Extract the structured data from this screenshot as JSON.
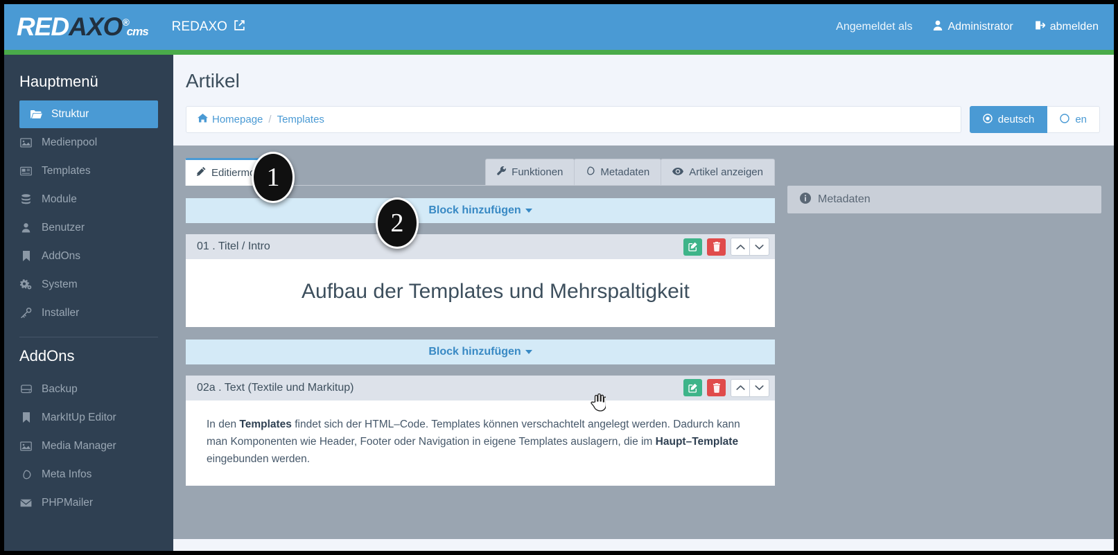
{
  "navbar": {
    "logo": {
      "part1": "RED",
      "part2": "AXO",
      "reg": "®",
      "cms": "cms"
    },
    "brand_link": "REDAXO",
    "brand_link_icon": "external-link-icon",
    "logged_in_as": "Angemeldet als",
    "user_name": "Administrator",
    "user_icon": "user-icon",
    "logout": "abmelden",
    "logout_icon": "sign-out-icon",
    "bg_color": "#4a9ad4",
    "accent_bar_color": "#4aab4a"
  },
  "sidebar": {
    "main_title": "Hauptmenü",
    "main_items": [
      {
        "label": "Struktur",
        "icon": "folder-open-icon",
        "glyph": "🗁",
        "active": true
      },
      {
        "label": "Medienpool",
        "icon": "image-icon",
        "glyph": "🖼",
        "active": false
      },
      {
        "label": "Templates",
        "icon": "newspaper-icon",
        "glyph": "🗞",
        "active": false
      },
      {
        "label": "Module",
        "icon": "database-icon",
        "glyph": "☰",
        "active": false
      },
      {
        "label": "Benutzer",
        "icon": "user-icon",
        "glyph": "👤",
        "active": false
      },
      {
        "label": "AddOns",
        "icon": "bookmark-icon",
        "glyph": "🔖",
        "active": false
      },
      {
        "label": "System",
        "icon": "cogs-icon",
        "glyph": "⚙",
        "active": false
      },
      {
        "label": "Installer",
        "icon": "key-icon",
        "glyph": "🔑",
        "active": false
      }
    ],
    "addons_title": "AddOns",
    "addon_items": [
      {
        "label": "Backup",
        "icon": "hdd-icon",
        "glyph": "⛁"
      },
      {
        "label": "MarkItUp Editor",
        "icon": "bookmark-icon",
        "glyph": "🔖"
      },
      {
        "label": "Media Manager",
        "icon": "image-icon",
        "glyph": "🖼"
      },
      {
        "label": "Meta Infos",
        "icon": "tag-icon",
        "glyph": "⬭"
      },
      {
        "label": "PHPMailer",
        "icon": "envelope-icon",
        "glyph": "✉"
      }
    ]
  },
  "page": {
    "title": "Artikel",
    "breadcrumb": {
      "home_icon": "home-icon",
      "items": [
        "Homepage",
        "Templates"
      ],
      "separator": "/"
    },
    "languages": [
      {
        "label": "deutsch",
        "selected": true,
        "icon": "radio-checked-icon"
      },
      {
        "label": "en",
        "selected": false,
        "icon": "radio-unchecked-icon"
      }
    ]
  },
  "tabs": {
    "left": [
      {
        "label": "Editiermodus",
        "icon": "pencil-icon",
        "active": true
      }
    ],
    "right": [
      {
        "label": "Funktionen",
        "icon": "wrench-icon",
        "active": false
      },
      {
        "label": "Metadaten",
        "icon": "tag-icon",
        "active": false
      },
      {
        "label": "Artikel anzeigen",
        "icon": "eye-icon",
        "active": false
      }
    ]
  },
  "add_block": {
    "label": "Block hinzufügen",
    "caret_icon": "caret-down-icon"
  },
  "blocks": [
    {
      "title": "01 . Titel / Intro",
      "actions": [
        {
          "name": "edit-button",
          "icon": "pencil-square-icon",
          "style": "green"
        },
        {
          "name": "delete-button",
          "icon": "trash-icon",
          "style": "red"
        },
        {
          "name": "move-up-button",
          "icon": "chevron-up-icon",
          "style": "white"
        },
        {
          "name": "move-down-button",
          "icon": "chevron-down-icon",
          "style": "white"
        }
      ],
      "heading": "Aufbau der Templates und Mehrspaltigkeit",
      "body": ""
    },
    {
      "title": "02a . Text (Textile und Markitup)",
      "actions": [
        {
          "name": "edit-button",
          "icon": "pencil-square-icon",
          "style": "green"
        },
        {
          "name": "delete-button",
          "icon": "trash-icon",
          "style": "red"
        },
        {
          "name": "move-up-button",
          "icon": "chevron-up-icon",
          "style": "white"
        },
        {
          "name": "move-down-button",
          "icon": "chevron-down-icon",
          "style": "white"
        }
      ],
      "heading": "",
      "body_parts": [
        {
          "text": "In den ",
          "bold": false
        },
        {
          "text": "Templates",
          "bold": true
        },
        {
          "text": " findet sich der HTML–Code. Templates können verschachtelt angelegt werden. Dadurch kann man Komponenten wie Header, Footer oder Navigation in eigene Templates auslagern, die im ",
          "bold": false
        },
        {
          "text": "Haupt–Template",
          "bold": true
        },
        {
          "text": " eingebunden werden.",
          "bold": false
        }
      ]
    }
  ],
  "metadata_panel": {
    "label": "Metadaten",
    "icon": "info-circle-icon"
  },
  "callouts": [
    {
      "number": "1"
    },
    {
      "number": "2"
    }
  ],
  "cursor": {
    "icon": "pointing-hand-cursor"
  },
  "colors": {
    "brand_blue": "#4a9ad4",
    "green": "#4aab4a",
    "sidebar_dark": "#2f4052",
    "workspace_grey": "#9aa5b1",
    "btn_green": "#3eb489",
    "btn_red": "#e04b4b",
    "addblock_bg": "#d4eaf7"
  }
}
